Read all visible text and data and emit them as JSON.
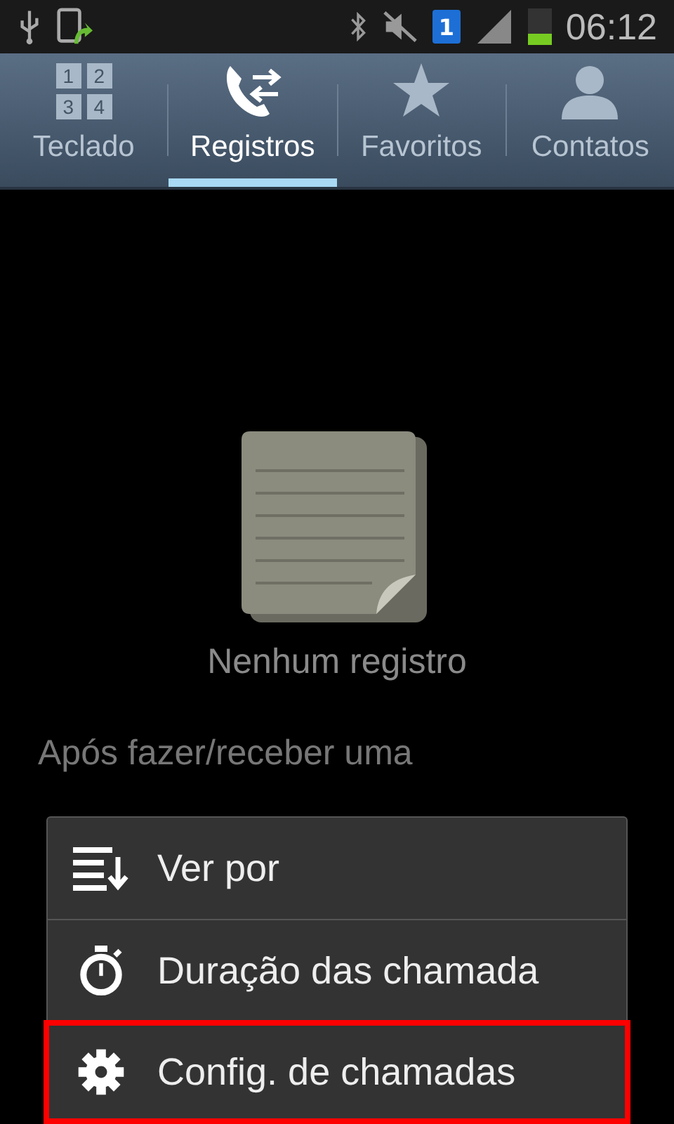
{
  "status_bar": {
    "sim_label": "1",
    "time": "06:12",
    "battery": {
      "level": 0.3
    }
  },
  "tabs": [
    {
      "kind": "keypad",
      "label": "Teclado",
      "selected": false,
      "digits": [
        "1",
        "2",
        "3",
        "4"
      ]
    },
    {
      "kind": "log",
      "label": "Registros",
      "selected": true
    },
    {
      "kind": "star",
      "label": "Favoritos",
      "selected": false
    },
    {
      "kind": "person",
      "label": "Contatos",
      "selected": false
    }
  ],
  "empty_state": {
    "title": "Nenhum registro",
    "description": "Após fazer/receber uma"
  },
  "menu": [
    {
      "kind": "sort",
      "label": "Ver por",
      "highlighted": false
    },
    {
      "kind": "timer",
      "label": "Duração das chamada",
      "highlighted": false
    },
    {
      "kind": "gear",
      "label": "Config. de chamadas",
      "highlighted": true
    }
  ]
}
